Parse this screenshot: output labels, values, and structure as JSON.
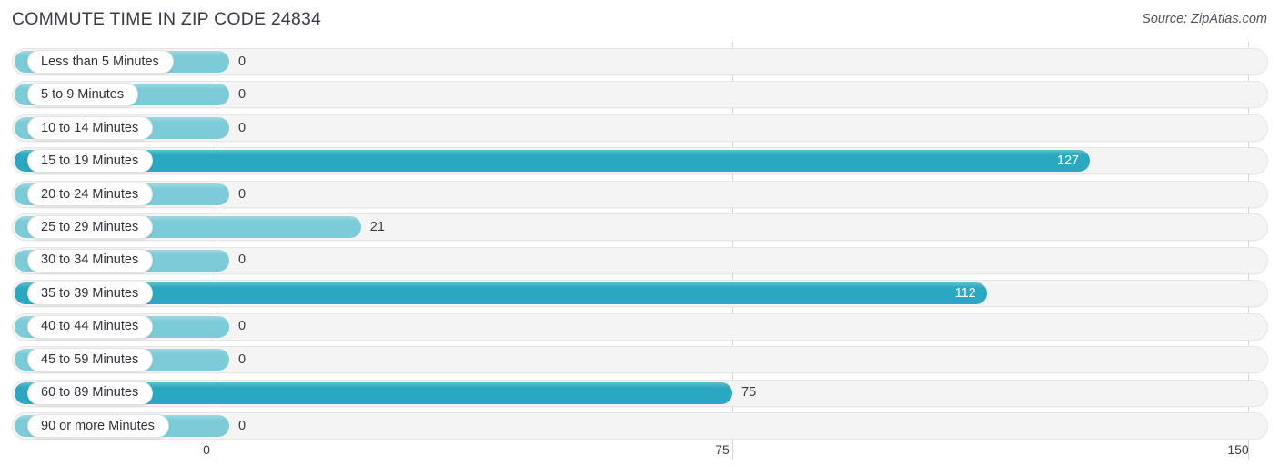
{
  "header": {
    "title": "COMMUTE TIME IN ZIP CODE 24834",
    "source": "Source: ZipAtlas.com"
  },
  "colors": {
    "bar_light": "#7ccbd8",
    "bar_dark": "#2ba8c1",
    "track": "#f4f4f4",
    "gridline": "#d8d8d8",
    "text": "#3b3b45"
  },
  "chart_data": {
    "type": "bar",
    "orientation": "horizontal",
    "title": "COMMUTE TIME IN ZIP CODE 24834",
    "subtitle": "Source: ZipAtlas.com",
    "xlabel": "",
    "ylabel": "",
    "xlim": [
      0,
      150
    ],
    "xticks": [
      0,
      75,
      150
    ],
    "xtick_labels": [
      "0",
      "75",
      "150"
    ],
    "grid": true,
    "legend": false,
    "categories": [
      "Less than 5 Minutes",
      "5 to 9 Minutes",
      "10 to 14 Minutes",
      "15 to 19 Minutes",
      "20 to 24 Minutes",
      "25 to 29 Minutes",
      "30 to 34 Minutes",
      "35 to 39 Minutes",
      "40 to 44 Minutes",
      "45 to 59 Minutes",
      "60 to 89 Minutes",
      "90 or more Minutes"
    ],
    "values": [
      0,
      0,
      0,
      127,
      0,
      21,
      0,
      112,
      0,
      0,
      75,
      0
    ],
    "value_labels": [
      "0",
      "0",
      "0",
      "127",
      "0",
      "21",
      "0",
      "112",
      "0",
      "0",
      "75",
      "0"
    ]
  }
}
